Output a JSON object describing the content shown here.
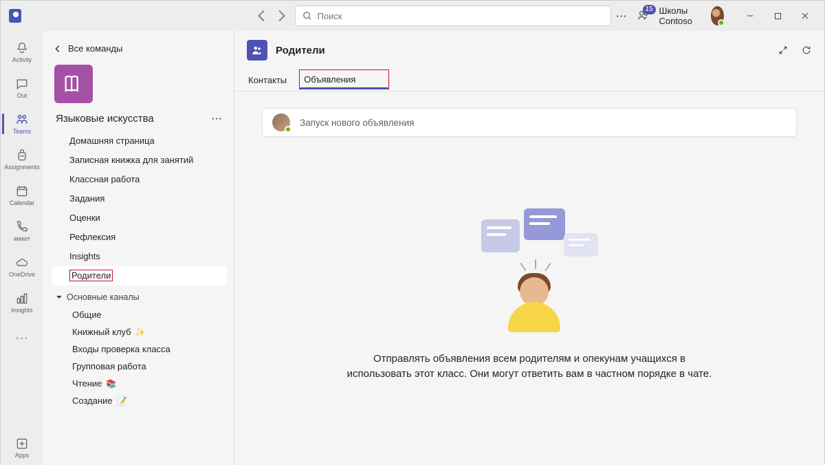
{
  "titlebar": {
    "search_placeholder": "Поиск",
    "org_name": "Школы Contoso",
    "notification_count": "15"
  },
  "rail": {
    "items": [
      {
        "label": "Activity"
      },
      {
        "label": "Out"
      },
      {
        "label": "Teams"
      },
      {
        "label": "Assignments"
      },
      {
        "label": "Calendar"
      },
      {
        "label": "макет"
      },
      {
        "label": "OneDrive"
      },
      {
        "label": "Insights"
      }
    ],
    "apps": "Apps"
  },
  "sidebar": {
    "back_label": "Все команды",
    "team_name": "Языковые искусства",
    "channels": [
      "Домашняя страница",
      "Записная книжка для занятий",
      "Классная работа",
      "Задания",
      "Оценки",
      "Рефлексия",
      "Insights",
      "Родители"
    ],
    "section_header": "Основные каналы",
    "sub_channels": [
      "Общие",
      "Книжный клуб",
      "Входы проверка класса",
      "Групповая работа",
      "Чтение",
      "Создание"
    ]
  },
  "header": {
    "title": "Родители"
  },
  "tabs": {
    "contacts": "Контакты",
    "announcements": "Объявления"
  },
  "compose": {
    "placeholder": "Запуск нового объявления"
  },
  "empty": {
    "line1": "Отправлять объявления всем родителям и опекунам учащихся в",
    "line2": "использовать этот класс. Они могут ответить вам в частном порядке в чате."
  }
}
